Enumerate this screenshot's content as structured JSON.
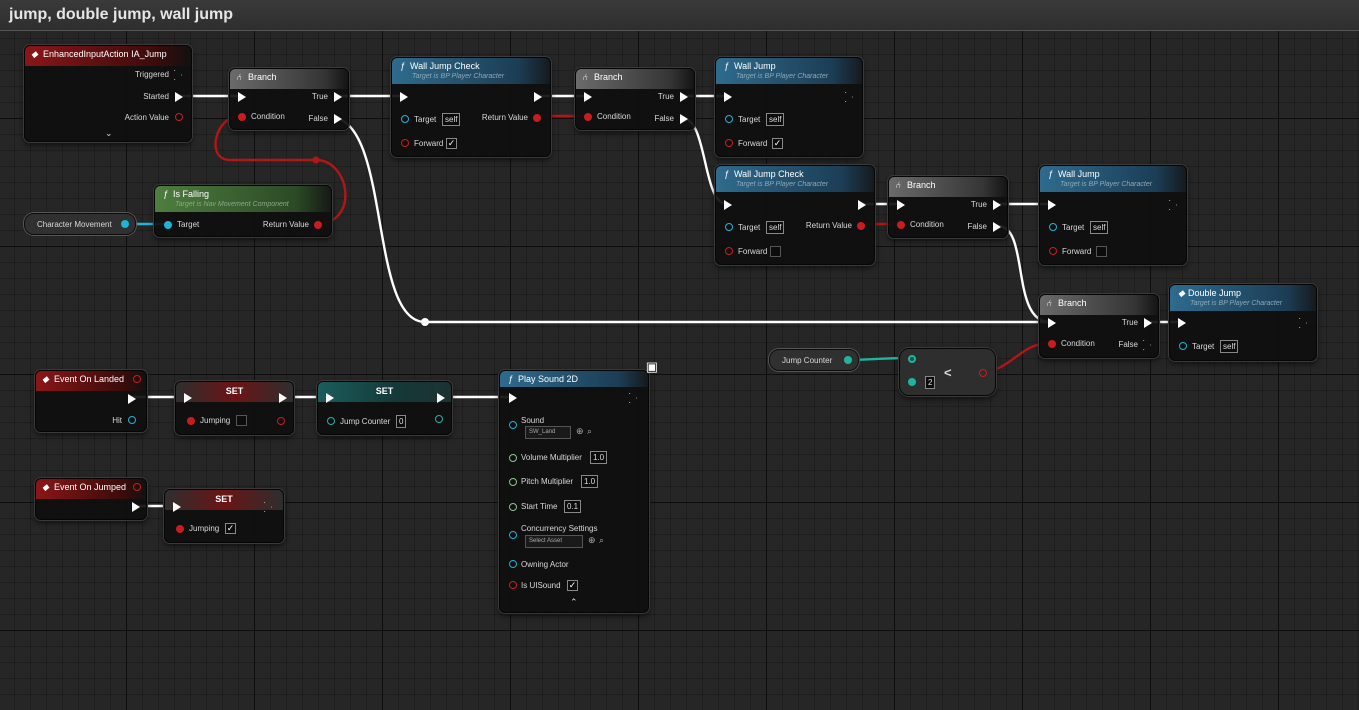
{
  "window_title": "jump, double jump, wall jump",
  "nodes": {
    "ia_jump": {
      "title": "EnhancedInputAction IA_Jump",
      "pins": [
        "Triggered",
        "Started",
        "Action Value"
      ]
    },
    "branch1": {
      "title": "Branch",
      "condition": "Condition",
      "true": "True",
      "false": "False"
    },
    "is_falling": {
      "title": "Is Falling",
      "subtitle": "Target is Nav Movement Component",
      "target": "Target",
      "return_value": "Return Value"
    },
    "char_movement": {
      "label": "Character Movement"
    },
    "wjc1": {
      "title": "Wall Jump Check",
      "subtitle": "Target is BP Player Character",
      "target": "Target",
      "target_value": "self",
      "return_value": "Return Value",
      "forward": "Forward",
      "forward_checked": true
    },
    "branch2": {
      "title": "Branch",
      "condition": "Condition",
      "true": "True",
      "false": "False"
    },
    "wj1": {
      "title": "Wall Jump",
      "subtitle": "Target is BP Player Character",
      "target": "Target",
      "target_value": "self",
      "forward": "Forward",
      "forward_checked": true
    },
    "wjc2": {
      "title": "Wall Jump Check",
      "subtitle": "Target is BP Player Character",
      "target": "Target",
      "target_value": "self",
      "return_value": "Return Value",
      "forward": "Forward",
      "forward_checked": false
    },
    "branch3": {
      "title": "Branch",
      "condition": "Condition",
      "true": "True",
      "false": "False"
    },
    "wj2": {
      "title": "Wall Jump",
      "subtitle": "Target is BP Player Character",
      "target": "Target",
      "target_value": "self",
      "forward": "Forward",
      "forward_checked": false
    },
    "branch4": {
      "title": "Branch",
      "condition": "Condition",
      "true": "True",
      "false": "False"
    },
    "double_jump": {
      "title": "Double Jump",
      "subtitle": "Target is BP Player Character",
      "target": "Target",
      "target_value": "self"
    },
    "jump_counter_get": {
      "label": "Jump Counter"
    },
    "less_than": {
      "operator": "<",
      "value": "2"
    },
    "on_landed": {
      "title": "Event On Landed",
      "hit": "Hit"
    },
    "set1": {
      "title": "SET",
      "var": "Jumping",
      "checked": false
    },
    "set2": {
      "title": "SET",
      "var": "Jump Counter",
      "value": "0"
    },
    "play_sound": {
      "title": "Play Sound 2D",
      "sound_label": "Sound",
      "sound_value": "SW_Land",
      "volume_label": "Volume Multiplier",
      "volume_value": "1.0",
      "pitch_label": "Pitch Multiplier",
      "pitch_value": "1.0",
      "start_label": "Start Time",
      "start_value": "0.1",
      "concurrency_label": "Concurrency Settings",
      "concurrency_value": "Select Asset",
      "owning_label": "Owning Actor",
      "ui_label": "Is UISound",
      "ui_checked": true
    },
    "on_jumped": {
      "title": "Event On Jumped"
    },
    "set3": {
      "title": "SET",
      "var": "Jumping",
      "checked": true
    }
  },
  "icons": {
    "event": "diamond-icon",
    "branch": "branch-icon",
    "function": "function-icon",
    "collapse": "chevron-icon",
    "monitor": "monitor-icon"
  },
  "colors": {
    "exec": "#ffffff",
    "bool": "#c81d1d",
    "object": "#1fb4d6",
    "float": "#8fc28f"
  }
}
